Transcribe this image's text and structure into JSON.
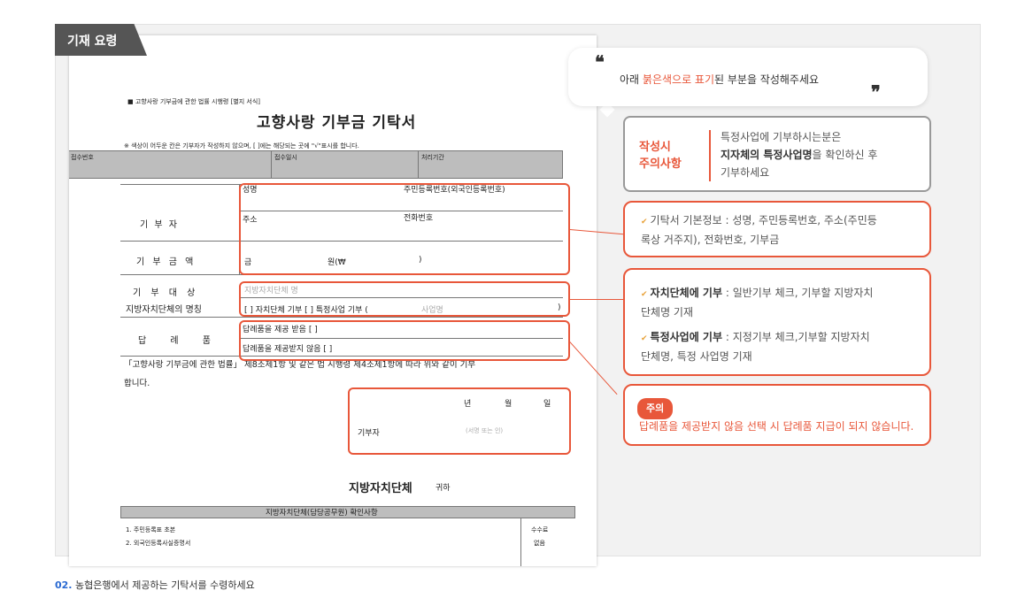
{
  "tab_label": "기재 요령",
  "form": {
    "law_ref": "■ 고향사랑 기부금에 관한 법률 시행령 [별지 서식]",
    "title": "고향사랑 기부금 기탁서",
    "instructions": "※ 색상이 어두운 칸은 기부자가 작성하지 않으며, [ ]에는 해당되는 곳에 \"√\"표시를 합니다.",
    "header_cols": [
      "접수번호",
      "접수일시",
      "처리기간"
    ],
    "donor_label": "기 부 자",
    "name_label": "성명",
    "rrn_label": "주민등록번호(외국인등록번호)",
    "address_label": "주소",
    "phone_label": "전화번호",
    "amount_label": "기 부 금 액",
    "amount_prefix": "금",
    "amount_suffix": "원(₩",
    "amount_close": ")",
    "target_label_1": "기 부 대 상",
    "target_label_2": "지방자치단체의 명칭",
    "target_placeholder": "지방자치단체 명",
    "target_options": "[ ] 자치단체 기부   [ ] 특정사업 기부 (",
    "business_placeholder": "사업명",
    "target_close": ")",
    "gift_label": "답 례 품",
    "gift_yes": "답례품을 제공 받음 [ ]",
    "gift_no": "답례품을 제공받지 않음 [ ]",
    "statement": "「고향사랑 기부금에 관한 법률」 제8조제1항 및 같은 법 시행령 제4조제1항에 따라 위와 같이 기부",
    "statement_2": "합니다.",
    "date_labels": [
      "년",
      "월",
      "일"
    ],
    "donor_sign_label": "기부자",
    "sign_hint": "(서명 또는 인)",
    "recipient": "지방자치단체",
    "recipient_suffix": "귀하",
    "confirm_title": "지방자치단체(담당공무원) 확인사항",
    "confirm_items": [
      "1. 주민등록표 초본",
      "2. 외국인등록사실증명서"
    ],
    "fee_label": "수수료",
    "fee_value": "없음"
  },
  "bubble": {
    "open_quote": "❝",
    "close_quote": "❞",
    "text_pre": "아래 ",
    "text_red": "붉은색으로 표기",
    "text_post": "된 부분을 작성해주세요"
  },
  "caution": {
    "label_1": "작성시",
    "label_2": "주의사항",
    "line_1": "특정사업에 기부하시는분은",
    "line_2_bold": "지자체의 특정사업명",
    "line_2_rest": "을 확인하신 후",
    "line_3": "기부하세요"
  },
  "card1": {
    "line_1": "기탁서 기본정보 : 성명, 주민등록번호, 주소(주민등",
    "line_2": "록상 거주지), 전화번호, 기부금"
  },
  "card2": {
    "item1_bold": "자치단체에 기부",
    "item1_rest": " : 일반기부 체크, 기부할 지방자치",
    "item1_line2": "단체명 기재",
    "item2_bold": "특정사업에 기부",
    "item2_rest": " : 지정기부 체크,기부할 지방자치",
    "item2_line2": "단체명, 특정 사업명 기재"
  },
  "card3": {
    "pill": "주의",
    "text": "답례품을 제공받지 않음 선택 시 답례품 지급이 되지 않습니다."
  },
  "footer": {
    "num": "02.",
    "text": " 농협은행에서 제공하는 기탁서를 수령하세요"
  },
  "colors": {
    "accent": "#e8573a",
    "step_number": "#2a6ad2"
  }
}
